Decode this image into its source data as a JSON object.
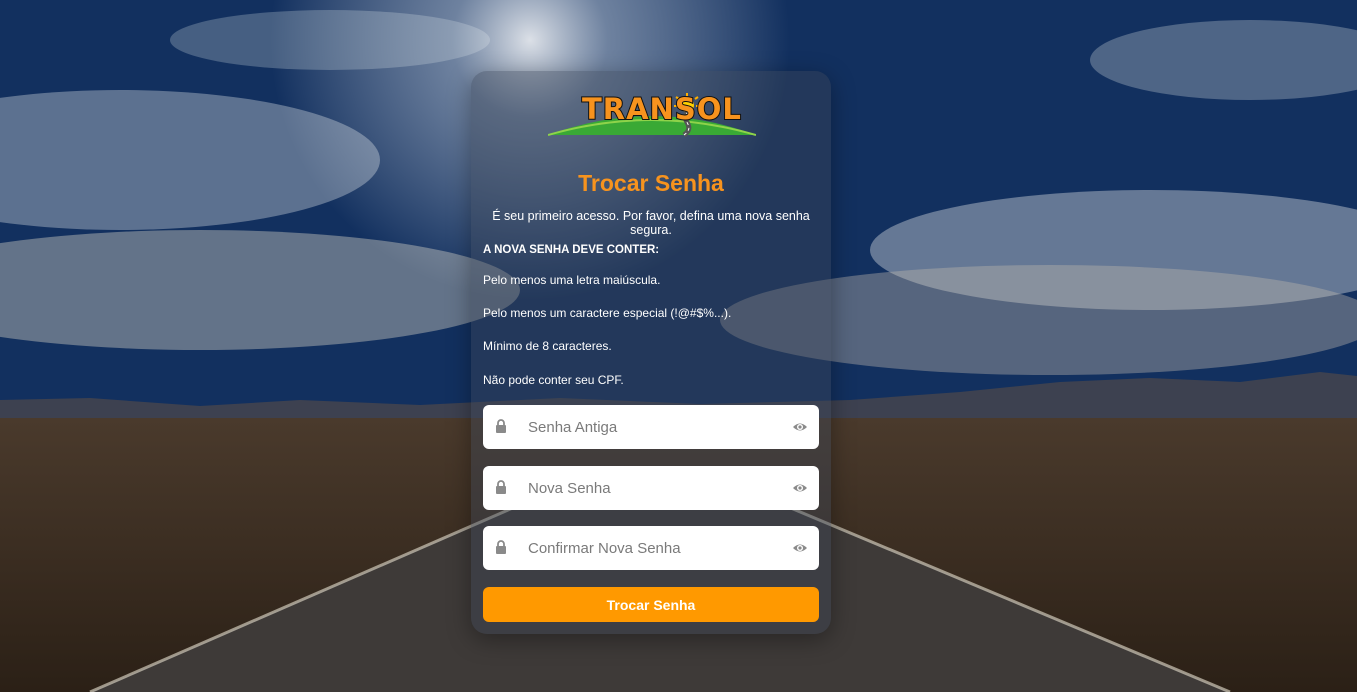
{
  "logo": {
    "text": "TRANSOL",
    "icon": "sun-road-logo"
  },
  "form": {
    "title": "Trocar Senha",
    "subtitle": "É seu primeiro acesso. Por favor, defina uma nova senha segura.",
    "requirements_heading": "A NOVA SENHA DEVE CONTER:",
    "requirements": [
      "Pelo menos uma letra maiúscula.",
      "Pelo menos um caractere especial (!@#$%...).",
      "Mínimo de 8 caracteres.",
      "Não pode conter seu CPF."
    ],
    "fields": [
      {
        "placeholder": "Senha Antiga",
        "value": ""
      },
      {
        "placeholder": "Nova Senha",
        "value": ""
      },
      {
        "placeholder": "Confirmar Nova Senha",
        "value": ""
      }
    ],
    "submit_label": "Trocar Senha"
  },
  "colors": {
    "accent": "#ff9900",
    "title": "#f7931e"
  }
}
